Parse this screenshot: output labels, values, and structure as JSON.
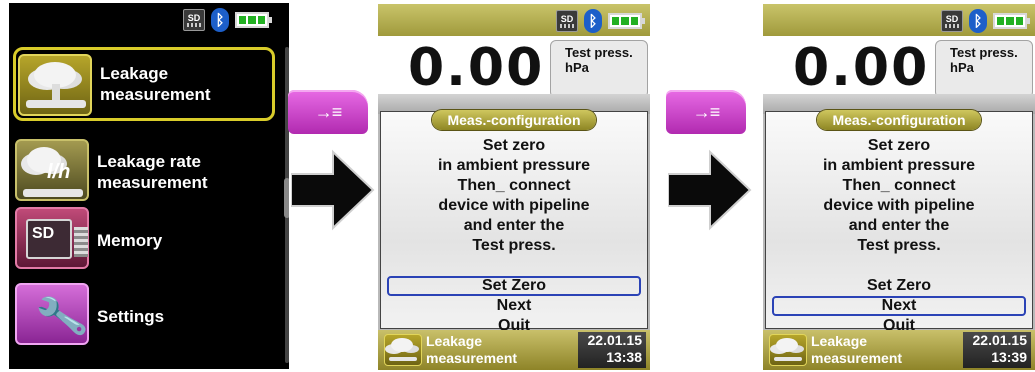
{
  "colors": {
    "accent_yellow": "#d9cc2a",
    "magenta_key": "#d24fcf",
    "selection_blue": "#2b43b6",
    "battery_green": "#22b022"
  },
  "status": {
    "sd_label": "SD",
    "bluetooth_icon": "bluetooth-icon",
    "battery_icon": "battery-full-icon"
  },
  "menu": {
    "items": [
      {
        "label": "Leakage\nmeasurement",
        "icon": "leakage-icon",
        "selected": true
      },
      {
        "label": "Leakage rate\nmeasurement",
        "icon": "leakage-rate-icon",
        "icon_text": "l/h"
      },
      {
        "label": "Memory",
        "icon": "sd-memory-icon",
        "icon_text": "SD"
      },
      {
        "label": "Settings",
        "icon": "wrench-icon"
      }
    ]
  },
  "key_label": "→≡",
  "screens": [
    {
      "reading": {
        "value": "0.00",
        "label": "Test press.",
        "unit": "hPa"
      },
      "dialog": {
        "title": "Meas.-configuration",
        "message": [
          "Set zero",
          "in ambient pressure",
          "Then_ connect",
          "device with pipeline",
          "and enter the",
          "Test press."
        ],
        "options": [
          "Set Zero",
          "Next",
          "Quit"
        ],
        "selected_index": 0
      },
      "footer": {
        "label": "Leakage\nmeasurement",
        "date": "22.01.15",
        "time": "13:38"
      }
    },
    {
      "reading": {
        "value": "0.00",
        "label": "Test press.",
        "unit": "hPa"
      },
      "dialog": {
        "title": "Meas.-configuration",
        "message": [
          "Set zero",
          "in ambient pressure",
          "Then_ connect",
          "device with pipeline",
          "and enter the",
          "Test press."
        ],
        "options": [
          "Set Zero",
          "Next",
          "Quit"
        ],
        "selected_index": 1
      },
      "footer": {
        "label": "Leakage\nmeasurement",
        "date": "22.01.15",
        "time": "13:39"
      }
    }
  ]
}
